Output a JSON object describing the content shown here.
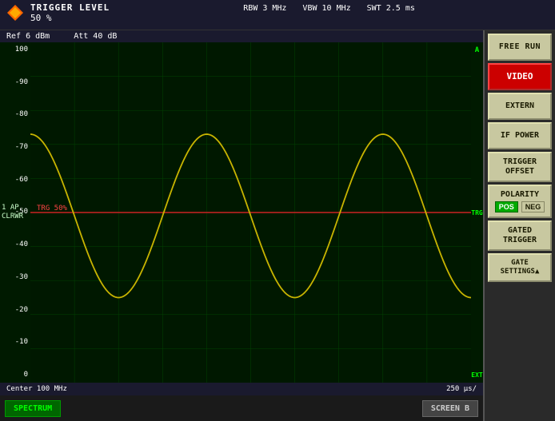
{
  "header": {
    "trigger_title": "TRIGGER LEVEL",
    "trigger_value": "50 %",
    "rbw_label": "RBW",
    "rbw_value": "3 MHz",
    "vbw_label": "VBW",
    "vbw_value": "10 MHz",
    "swt_label": "SWT",
    "swt_value": "2.5 ms",
    "ref_label": "Ref",
    "ref_value": "6 dBm",
    "att_label": "Att",
    "att_value": "40 dB"
  },
  "chart": {
    "y_labels": [
      "100",
      "-90",
      "-80",
      "-70",
      "-60",
      "-50",
      "-40",
      "-30",
      "-20",
      "-10",
      "0"
    ],
    "trg_label": "TRG 50%",
    "left_label": "1 AP\nCLRWR",
    "indicator_a": "A",
    "indicator_trg": "TRG",
    "indicator_ext": "EXT",
    "center_freq": "Center 100 MHz",
    "sweep_time": "250 µs/"
  },
  "right_panel": {
    "free_run": "FREE RUN",
    "video": "VIDEO",
    "extern": "EXTERN",
    "if_power": "IF POWER",
    "trigger_offset": "TRIGGER\nOFFSET",
    "polarity": "POLARITY",
    "pos": "POS",
    "neg": "NEG",
    "gated_trigger": "GATED\nTRIGGER",
    "gate_settings": "GATE\nSETTINGS▲"
  },
  "footer": {
    "spectrum_label": "SPECTRUM",
    "screen_b_label": "SCREEN B"
  }
}
